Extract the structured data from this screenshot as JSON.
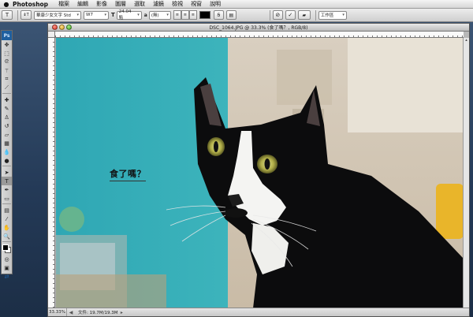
{
  "menubar": {
    "apple_icon": "apple-icon",
    "app_name": "Photoshop",
    "items": [
      "檔案",
      "編輯",
      "影像",
      "圖層",
      "選取",
      "濾鏡",
      "檢視",
      "視窗",
      "說明"
    ]
  },
  "optionsbar": {
    "tool_glyph": "T",
    "orientation_glyph": "↨T",
    "font_family": "華康少女文字 Std",
    "font_style": "W7",
    "size_glyph": "T",
    "font_size": "24.04 點",
    "aa_glyph": "a",
    "antialias": "(無)",
    "workspace": "工作區"
  },
  "document": {
    "title": "DSC_1064.JPG @ 33.3% (食了嗎？, RGB/8)",
    "canvas_text": "食了嗎？"
  },
  "statusbar": {
    "zoom": "33.33%",
    "file_info": "文件: 19.7M/19.3M"
  },
  "colors": {
    "foreground": "#000000",
    "background": "#ffffff",
    "photo_wall": "#3fb6bd"
  }
}
